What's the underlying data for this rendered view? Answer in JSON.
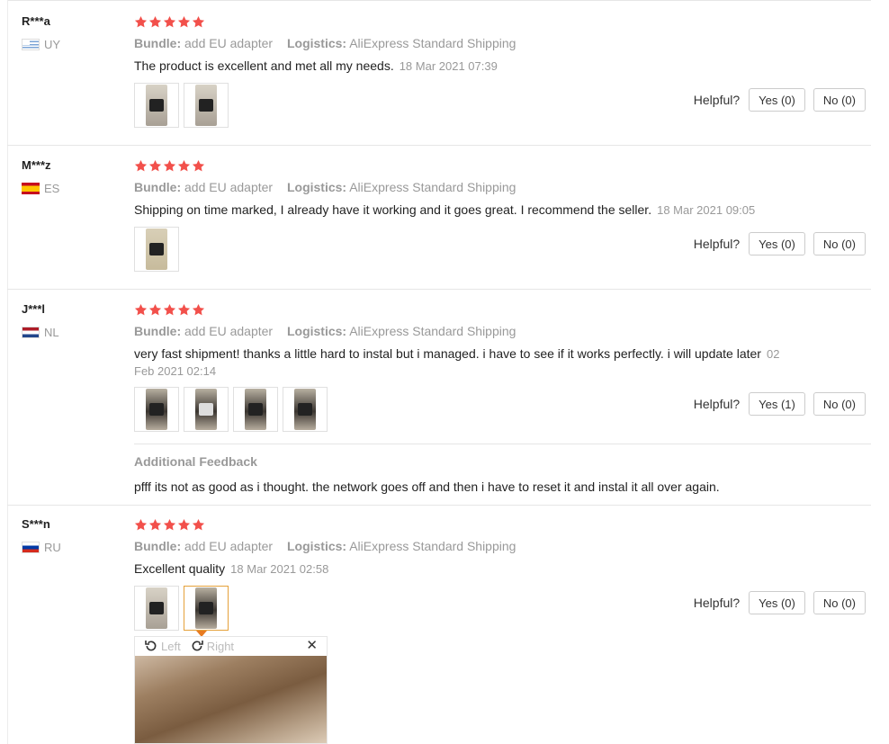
{
  "reviews": [
    {
      "user": "R***a",
      "country": "UY",
      "bundle_label": "Bundle:",
      "bundle": "add EU adapter",
      "logistics_label": "Logistics:",
      "logistics": "AliExpress Standard Shipping",
      "text": "The product is excellent and met all my needs.",
      "time": "18 Mar 2021 07:39",
      "helpful_label": "Helpful?",
      "yes": "Yes (0)",
      "no": "No (0)",
      "rating": 5
    },
    {
      "user": "M***z",
      "country": "ES",
      "bundle_label": "Bundle:",
      "bundle": "add EU adapter",
      "logistics_label": "Logistics:",
      "logistics": "AliExpress Standard Shipping",
      "text": "Shipping on time marked, I already have it working and it goes great. I recommend the seller.",
      "time": "18 Mar 2021 09:05",
      "helpful_label": "Helpful?",
      "yes": "Yes (0)",
      "no": "No (0)",
      "rating": 5
    },
    {
      "user": "J***l",
      "country": "NL",
      "bundle_label": "Bundle:",
      "bundle": "add EU adapter",
      "logistics_label": "Logistics:",
      "logistics": "AliExpress Standard Shipping",
      "text": "very fast shipment! thanks a little hard to instal but i managed. i have to see if it works perfectly. i will update later",
      "time_part1": "02",
      "time_part2": "Feb 2021 02:14",
      "helpful_label": "Helpful?",
      "yes": "Yes (1)",
      "no": "No (0)",
      "additional_title": "Additional Feedback",
      "additional_text": "pfff its not as good as i thought. the network goes off and then i have to reset it and instal it all over again.",
      "rating": 5
    },
    {
      "user": "S***n",
      "country": "RU",
      "bundle_label": "Bundle:",
      "bundle": "add EU adapter",
      "logistics_label": "Logistics:",
      "logistics": "AliExpress Standard Shipping",
      "text": "Excellent quality",
      "time": "18 Mar 2021 02:58",
      "helpful_label": "Helpful?",
      "yes": "Yes (0)",
      "no": "No (0)",
      "rating": 5
    }
  ],
  "viewer": {
    "left_label": "Left",
    "right_label": "Right",
    "close": "✕"
  },
  "colors": {
    "star": "#f2504b",
    "muted": "#999999",
    "active_border": "#e5a13a"
  }
}
